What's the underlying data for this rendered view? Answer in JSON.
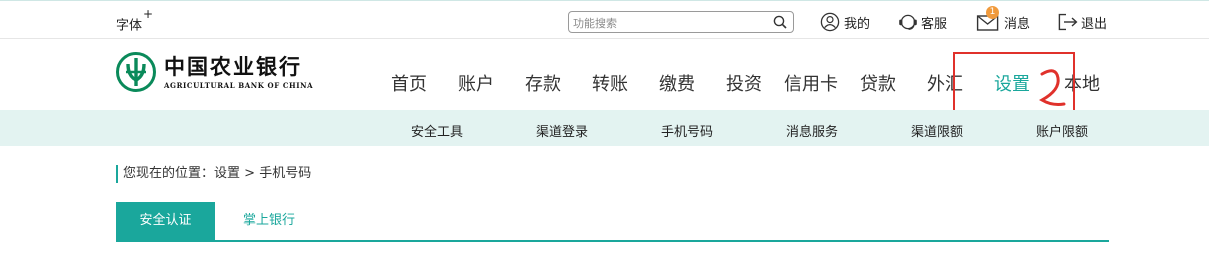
{
  "topbar": {
    "font_size_label": "字体",
    "font_size_plus": "+",
    "search_placeholder": "功能搜索",
    "my_label": "我的",
    "service_label": "客服",
    "messages_label": "消息",
    "messages_badge": "1",
    "logout_label": "退出"
  },
  "logo": {
    "name_cn": "中国农业银行",
    "name_en": "AGRICULTURAL BANK OF CHINA",
    "brand_color": "#0a8a5a"
  },
  "nav": {
    "items": [
      "首页",
      "账户",
      "存款",
      "转账",
      "缴费",
      "投资",
      "信用卡",
      "贷款",
      "外汇",
      "设置",
      "本地"
    ],
    "active_index": 9,
    "accent_color": "#1aa79c"
  },
  "subnav": {
    "items": [
      "安全工具",
      "渠道登录",
      "手机号码",
      "消息服务",
      "渠道限额",
      "账户限额"
    ],
    "background_color": "#e3f3f1"
  },
  "breadcrumb": {
    "prefix": "您现在的位置：",
    "level1": "设置",
    "separator": " > ",
    "level2": "手机号码"
  },
  "tabs": {
    "items": [
      "安全认证",
      "掌上银行"
    ],
    "active_index": 0
  },
  "annotation": {
    "color": "#e0312b"
  }
}
